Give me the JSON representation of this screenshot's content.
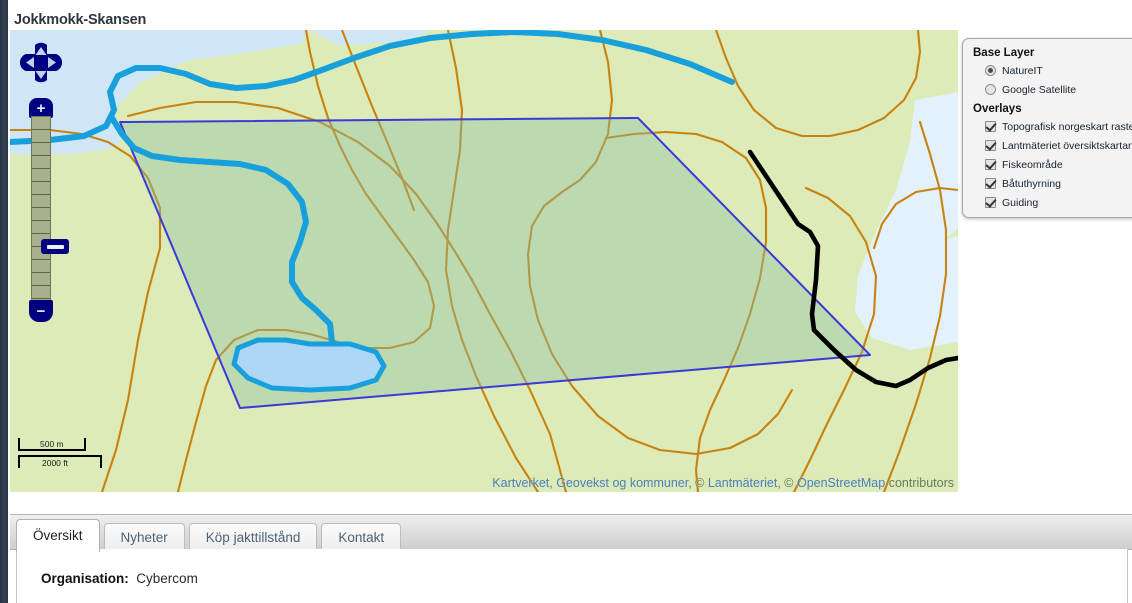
{
  "page": {
    "title": "Jokkmokk-Skansen"
  },
  "map": {
    "attribution": {
      "part1": "Kartverket, Geovekst og kommuner",
      "sep1": ", © ",
      "part2": "Lantmäteriet",
      "sep2": ", © ",
      "part3": "OpenStreetMap",
      "suffix": " contributors"
    },
    "scalebar": {
      "metric": "500 m",
      "imperial": "2000 ft"
    },
    "controls": {
      "pan_north": "Pan North",
      "pan_south": "Pan South",
      "pan_west": "Pan West",
      "pan_east": "Pan East",
      "zoom_in": "+",
      "zoom_out": "−"
    },
    "colors": {
      "water": "#cfe6f7",
      "water_fill_lake": "#aed6f7",
      "water_stroke": "#18a0dc",
      "land_light": "#dcebb7",
      "land_mid": "#cfe5b4",
      "contour": "#c8820f",
      "polygon_stroke": "#3b39d8",
      "polygon_fill": "rgba(140,190,160,0.38)",
      "road_black": "#000000",
      "control_navy": "#000080"
    }
  },
  "layer_panel": {
    "base_layer_heading": "Base Layer",
    "base_layers": [
      {
        "label": "NatureIT",
        "selected": true
      },
      {
        "label": "Google Satellite",
        "selected": false
      }
    ],
    "overlays_heading": "Overlays",
    "overlays": [
      {
        "label": "Topografisk norgeskart raster",
        "checked": true
      },
      {
        "label": "Lantmäteriet översiktskartan",
        "checked": true
      },
      {
        "label": "Fiskeområde",
        "checked": true
      },
      {
        "label": "Båtuthyrning",
        "checked": true
      },
      {
        "label": "Guiding",
        "checked": true
      }
    ]
  },
  "tabs": [
    {
      "label": "Översikt",
      "active": true
    },
    {
      "label": "Nyheter",
      "active": false
    },
    {
      "label": "Köp jakttillstånd",
      "active": false
    },
    {
      "label": "Kontakt",
      "active": false
    }
  ],
  "content": {
    "org_label": "Organisation:",
    "org_value": "Cybercom"
  }
}
